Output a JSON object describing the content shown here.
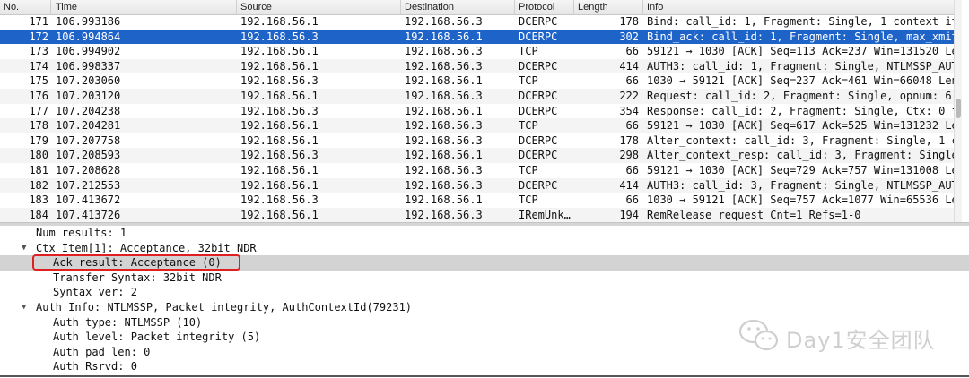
{
  "columns": {
    "no": "No.",
    "time": "Time",
    "source": "Source",
    "destination": "Destination",
    "protocol": "Protocol",
    "length": "Length",
    "info": "Info"
  },
  "packets": [
    {
      "no": "171",
      "time": "106.993186",
      "src": "192.168.56.1",
      "dst": "192.168.56.3",
      "proto": "DCERPC",
      "len": "178",
      "info": "Bind: call_id: 1, Fragment: Single, 1 context it…"
    },
    {
      "no": "172",
      "time": "106.994864",
      "src": "192.168.56.3",
      "dst": "192.168.56.1",
      "proto": "DCERPC",
      "len": "302",
      "info": "Bind_ack: call_id: 1, Fragment: Single, max_xmit…"
    },
    {
      "no": "173",
      "time": "106.994902",
      "src": "192.168.56.1",
      "dst": "192.168.56.3",
      "proto": "TCP",
      "len": "66",
      "info": "59121 → 1030 [ACK] Seq=113 Ack=237 Win=131520 Le…"
    },
    {
      "no": "174",
      "time": "106.998337",
      "src": "192.168.56.1",
      "dst": "192.168.56.3",
      "proto": "DCERPC",
      "len": "414",
      "info": "AUTH3: call_id: 1, Fragment: Single, NTLMSSP_AUT…"
    },
    {
      "no": "175",
      "time": "107.203060",
      "src": "192.168.56.3",
      "dst": "192.168.56.1",
      "proto": "TCP",
      "len": "66",
      "info": "1030 → 59121 [ACK] Seq=237 Ack=461 Win=66048 Len…"
    },
    {
      "no": "176",
      "time": "107.203120",
      "src": "192.168.56.1",
      "dst": "192.168.56.3",
      "proto": "DCERPC",
      "len": "222",
      "info": "Request: call_id: 2, Fragment: Single, opnum: 6,…"
    },
    {
      "no": "177",
      "time": "107.204238",
      "src": "192.168.56.3",
      "dst": "192.168.56.1",
      "proto": "DCERPC",
      "len": "354",
      "info": "Response: call_id: 2, Fragment: Single, Ctx: 0 f…"
    },
    {
      "no": "178",
      "time": "107.204281",
      "src": "192.168.56.1",
      "dst": "192.168.56.3",
      "proto": "TCP",
      "len": "66",
      "info": "59121 → 1030 [ACK] Seq=617 Ack=525 Win=131232 Le…"
    },
    {
      "no": "179",
      "time": "107.207758",
      "src": "192.168.56.1",
      "dst": "192.168.56.3",
      "proto": "DCERPC",
      "len": "178",
      "info": "Alter_context: call_id: 3, Fragment: Single, 1 c…"
    },
    {
      "no": "180",
      "time": "107.208593",
      "src": "192.168.56.3",
      "dst": "192.168.56.1",
      "proto": "DCERPC",
      "len": "298",
      "info": "Alter_context_resp: call_id: 3, Fragment: Single…"
    },
    {
      "no": "181",
      "time": "107.208628",
      "src": "192.168.56.1",
      "dst": "192.168.56.3",
      "proto": "TCP",
      "len": "66",
      "info": "59121 → 1030 [ACK] Seq=729 Ack=757 Win=131008 Le…"
    },
    {
      "no": "182",
      "time": "107.212553",
      "src": "192.168.56.1",
      "dst": "192.168.56.3",
      "proto": "DCERPC",
      "len": "414",
      "info": "AUTH3: call_id: 3, Fragment: Single, NTLMSSP_AUT…"
    },
    {
      "no": "183",
      "time": "107.413672",
      "src": "192.168.56.3",
      "dst": "192.168.56.1",
      "proto": "TCP",
      "len": "66",
      "info": "1030 → 59121 [ACK] Seq=757 Ack=1077 Win=65536 Le…"
    },
    {
      "no": "184",
      "time": "107.413726",
      "src": "192.168.56.1",
      "dst": "192.168.56.3",
      "proto": "IRemUnk…",
      "len": "194",
      "info": "RemRelease request Cnt=1 Refs=1-0"
    }
  ],
  "selected_packet": "172",
  "details": [
    {
      "text": "Num results: 1",
      "indent": 40,
      "expander": ""
    },
    {
      "text": "Ctx Item[1]: Acceptance, 32bit NDR",
      "indent": 40,
      "expander": "open"
    },
    {
      "text": "Ack result: Acceptance (0)",
      "indent": 59,
      "expander": "",
      "highlight": true
    },
    {
      "text": "Transfer Syntax: 32bit NDR",
      "indent": 59,
      "expander": ""
    },
    {
      "text": "Syntax ver: 2",
      "indent": 59,
      "expander": ""
    },
    {
      "text": "Auth Info: NTLMSSP, Packet integrity, AuthContextId(79231)",
      "indent": 40,
      "expander": "open"
    },
    {
      "text": "Auth type: NTLMSSP (10)",
      "indent": 59,
      "expander": ""
    },
    {
      "text": "Auth level: Packet integrity (5)",
      "indent": 59,
      "expander": ""
    },
    {
      "text": "Auth pad len: 0",
      "indent": 59,
      "expander": ""
    },
    {
      "text": "Auth Rsrvd: 0",
      "indent": 59,
      "expander": ""
    }
  ],
  "watermark": "Day1安全团队",
  "colors": {
    "selection": "#1e63c8",
    "annotation": "#e02020"
  }
}
